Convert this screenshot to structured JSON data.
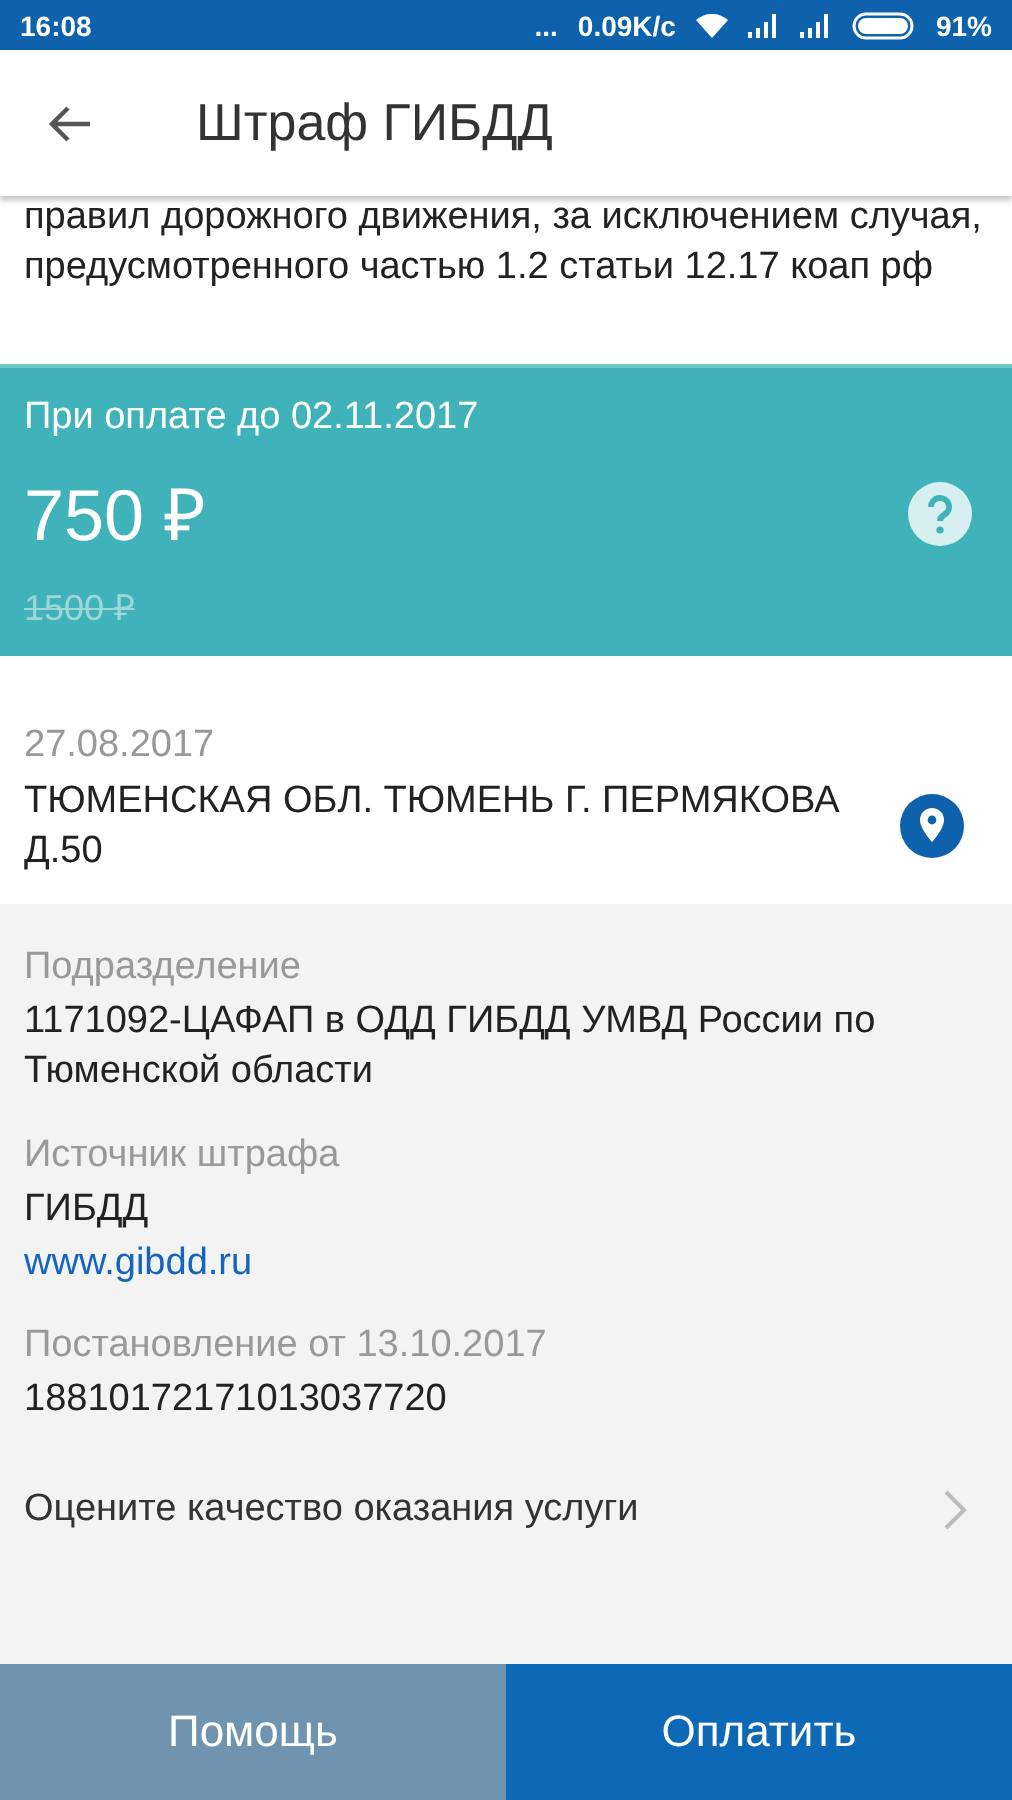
{
  "status_bar": {
    "time": "16:08",
    "more": "...",
    "speed": "0.09K/c",
    "battery": "91%"
  },
  "app_bar": {
    "title": "Штраф ГИБДД"
  },
  "description": "правил дорожного движения, за исключением случая, предусмотренного частью 1.2 статьи 12.17 коап рф",
  "discount": {
    "label": "При оплате до 02.11.2017",
    "amount": "750 ₽",
    "old_amount": "1500 ₽"
  },
  "violation": {
    "date": "27.08.2017",
    "place": "ТЮМЕНСКАЯ ОБЛ. ТЮМЕНЬ Г. ПЕРМЯКОВА Д.50"
  },
  "details": [
    {
      "kind": "text",
      "label": "Подразделение",
      "value": "1171092-ЦАФАП в ОДД ГИБДД УМВД России по Тюменской области"
    },
    {
      "kind": "link",
      "label": "Источник штрафа",
      "value": "ГИБДД",
      "link": "www.gibdd.ru"
    },
    {
      "kind": "text",
      "label": "Постановление от 13.10.2017",
      "value": "18810172171013037720"
    }
  ],
  "rating_row": {
    "label": "Оцените качество оказания услуги"
  },
  "buttons": [
    {
      "label": "Помощь",
      "kind": "secondary"
    },
    {
      "label": "Оплатить",
      "kind": "primary"
    }
  ]
}
